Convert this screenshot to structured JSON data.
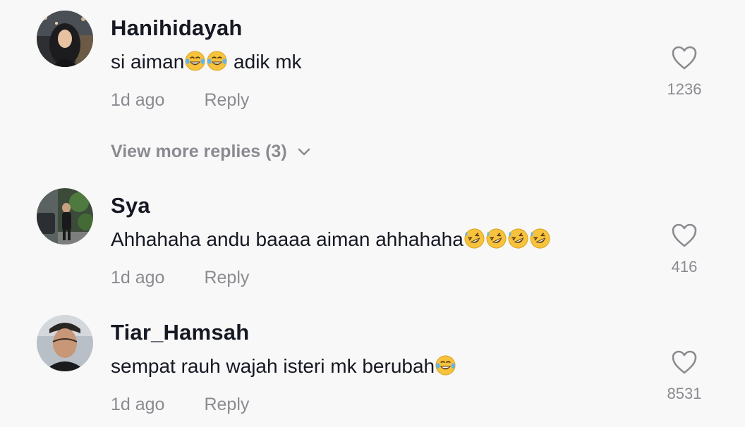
{
  "comments": [
    {
      "username": "Hanihidayah",
      "text": "si aiman",
      "text_suffix": " adik mk",
      "emoji_mid": [
        "tears-of-joy-emoji",
        "tears-of-joy-emoji"
      ],
      "time": "1d ago",
      "reply_label": "Reply",
      "likes": "1236",
      "view_more": "View more replies (3)"
    },
    {
      "username": "Sya",
      "text": "Ahhahaha andu baaaa aiman ahhahaha",
      "emoji_end": [
        "rolling-on-floor-laughing-emoji",
        "rolling-on-floor-laughing-emoji",
        "rolling-on-floor-laughing-emoji",
        "rolling-on-floor-laughing-emoji"
      ],
      "time": "1d ago",
      "reply_label": "Reply",
      "likes": "416"
    },
    {
      "username": "Tiar_Hamsah",
      "text": "sempat rauh wajah isteri mk berubah",
      "emoji_end": [
        "tears-of-joy-emoji"
      ],
      "time": "1d ago",
      "reply_label": "Reply",
      "likes": "8531"
    }
  ],
  "colors": {
    "background": "#f8f8f8",
    "username": "#161823",
    "secondary": "#8a8b91",
    "emoji_yellow": "#f7c23c"
  }
}
